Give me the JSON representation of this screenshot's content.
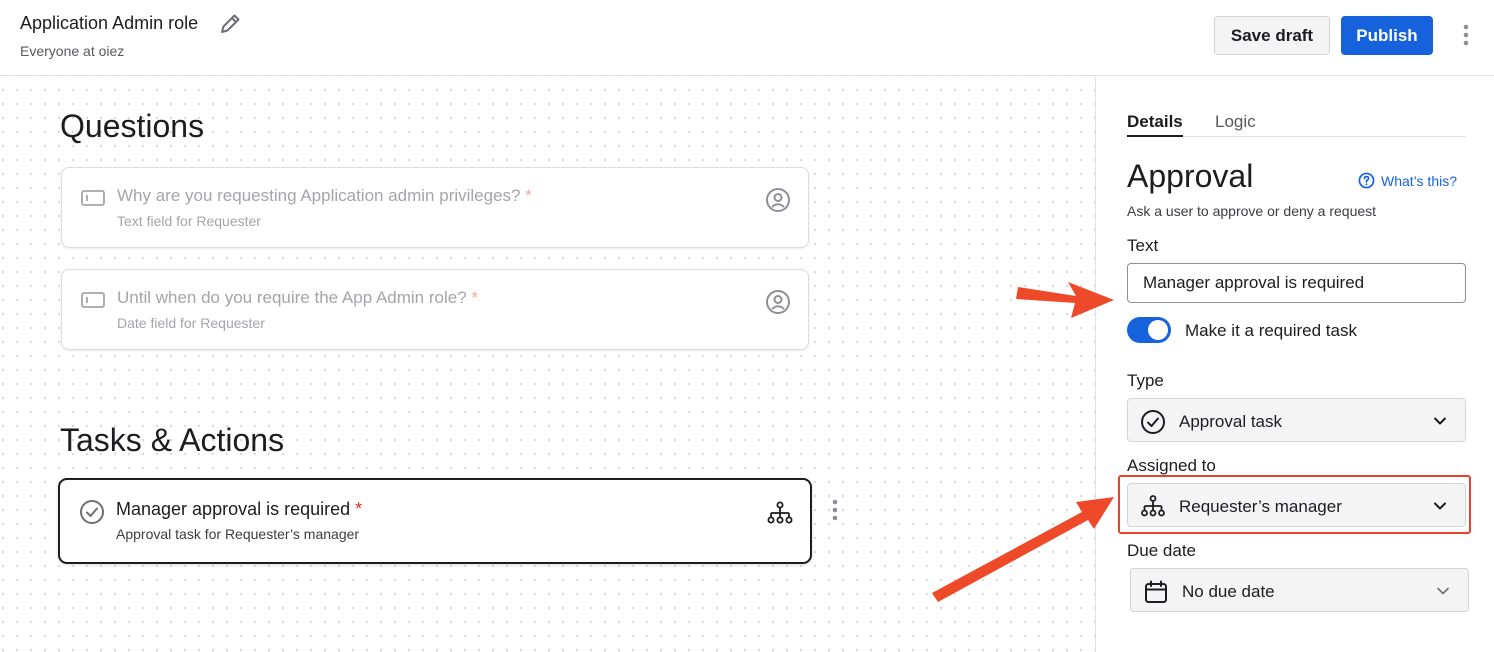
{
  "header": {
    "title": "Application Admin role",
    "subtitle": "Everyone at oiez",
    "save_draft": "Save draft",
    "publish": "Publish"
  },
  "canvas": {
    "questions_title": "Questions",
    "questions": [
      {
        "text": "Why are you requesting Application admin privileges?",
        "required": "*",
        "sub": "Text field for Requester"
      },
      {
        "text": "Until when do you require the App Admin role?",
        "required": "*",
        "sub": "Date field for Requester"
      }
    ],
    "tasks_title": "Tasks & Actions",
    "task": {
      "text": "Manager approval is required",
      "required": "*",
      "sub": "Approval task for Requester’s manager"
    }
  },
  "panel": {
    "tabs": [
      "Details",
      "Logic"
    ],
    "title": "Approval",
    "whats_this": "What’s this?",
    "description": "Ask a user to approve or deny a request",
    "text_label": "Text",
    "text_value": "Manager approval is required",
    "toggle_label": "Make it a required task",
    "toggle_on": true,
    "type_label": "Type",
    "type_value": "Approval task",
    "assigned_label": "Assigned to",
    "assigned_value": "Requester’s manager",
    "due_label": "Due date",
    "due_value": "No due date"
  },
  "colors": {
    "accent": "#1662dd",
    "annotation": "#e8432a",
    "required_star": "#d93025"
  }
}
